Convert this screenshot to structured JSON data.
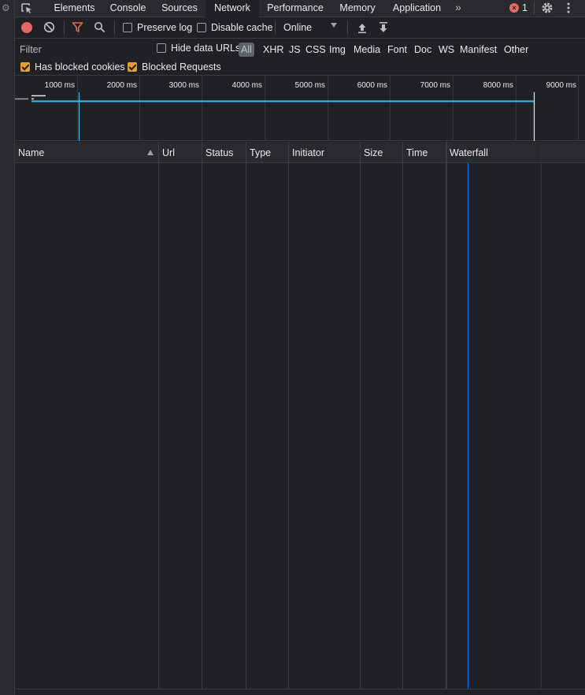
{
  "tabs": [
    {
      "label": "Elements"
    },
    {
      "label": "Console"
    },
    {
      "label": "Sources"
    },
    {
      "label": "Network"
    },
    {
      "label": "Performance"
    },
    {
      "label": "Memory"
    },
    {
      "label": "Application"
    }
  ],
  "active_tab": "Network",
  "more_tabs_glyph": "»",
  "error_count": "1",
  "error_icon_glyph": "×",
  "toolbar": {
    "preserve_log": "Preserve log",
    "disable_cache": "Disable cache",
    "throttling": "Online"
  },
  "filter": {
    "placeholder": "Filter",
    "hide_data_urls": "Hide data URLs",
    "types": [
      "All",
      "XHR",
      "JS",
      "CSS",
      "Img",
      "Media",
      "Font",
      "Doc",
      "WS",
      "Manifest",
      "Other"
    ],
    "has_blocked_cookies": "Has blocked cookies",
    "blocked_requests": "Blocked Requests"
  },
  "timeline": {
    "ticks": [
      "1000 ms",
      "2000 ms",
      "3000 ms",
      "4000 ms",
      "5000 ms",
      "6000 ms",
      "7000 ms",
      "8000 ms",
      "9000 ms"
    ]
  },
  "columns": [
    "Name",
    "Url",
    "Status",
    "Type",
    "Initiator",
    "Size",
    "Time",
    "Waterfall"
  ],
  "colors": {
    "record": "#e46962",
    "checkbox_checked": "#e39e3a",
    "dom_content_loaded": "#1a73e8",
    "overview_line": "#4ab6e8",
    "load_event": "#e8eaed"
  }
}
